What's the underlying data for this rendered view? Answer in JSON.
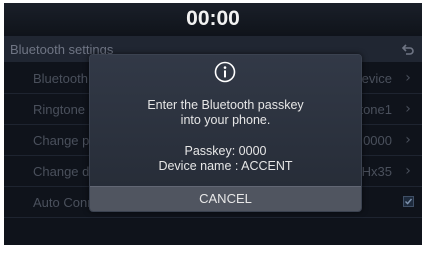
{
  "status_bar": {
    "clock": "00:00"
  },
  "header": {
    "title": "Bluetooth settings"
  },
  "settings_list": [
    {
      "label": "Bluetooth connection",
      "value": "Device"
    },
    {
      "label": "Ringtone",
      "value": "Ringtone1"
    },
    {
      "label": "Change passkey",
      "value": "0000"
    },
    {
      "label": "Change device name",
      "value": "Hx35"
    },
    {
      "label": "Auto Connection",
      "checked": true
    }
  ],
  "dialog": {
    "icon": "info-icon",
    "message_line1": "Enter the Bluetooth passkey",
    "message_line2": "into your phone.",
    "passkey_line": "Passkey: 0000",
    "device_line": "Device name : ACCENT",
    "cancel_label": "CANCEL"
  }
}
